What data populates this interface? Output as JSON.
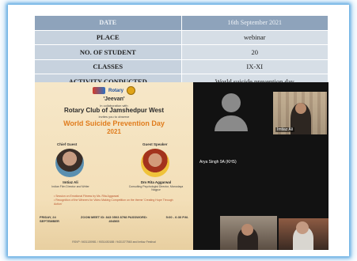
{
  "table": {
    "header": {
      "left": "DATE",
      "right": "16th September 2021"
    },
    "rows": [
      {
        "label": "PLACE",
        "value": "webinar"
      },
      {
        "label": "NO. OF STUDENT",
        "value": "20"
      },
      {
        "label": "CLASSES",
        "value": "IX-XI"
      },
      {
        "label": "ACTIVITY CONDUCTED",
        "value": "World suicide prevention day"
      }
    ]
  },
  "poster": {
    "rotary_text": "Rotary",
    "title": "'Jeevan'",
    "sub": "in collaboration with",
    "club": "Rotary Club of Jamshedpur West",
    "sub2": "invites you to observe",
    "event": "World Suicide Prevention Day",
    "year": "2021",
    "chief_role": "Chief Guest",
    "guest_role": "Guest Speaker",
    "chief_name": "Imtiaz Ali",
    "chief_desc": "Indian Film Director and Writer",
    "guest_name": "Dm Rita Aggarwal",
    "guest_desc": "Consulting Psychologist Director, Manodaya Nagpur",
    "bullet1": "• Session on Emotional Fitness by Ms. Rita Aggarwal",
    "bullet2": "• Recognition of the Winners for Video Making Competition on the theme 'Creating Hope Through Action'",
    "footer_left": "FRIDAY, 24 SEPTEMBER",
    "footer_mid": "ZOOM MEET ID: 843 0503 8798 PASSWORD: 494565",
    "footer_right": "5:00 - 6:30 P.M.",
    "bottom": "RSVP: 9431130981 / 9031430188 / 9431377560 and Imtiaz Festival"
  },
  "video": {
    "tile_label_imtiaz": "Imtiaz Ali",
    "arya_label": "Arya Singh 9A (KHS)"
  }
}
